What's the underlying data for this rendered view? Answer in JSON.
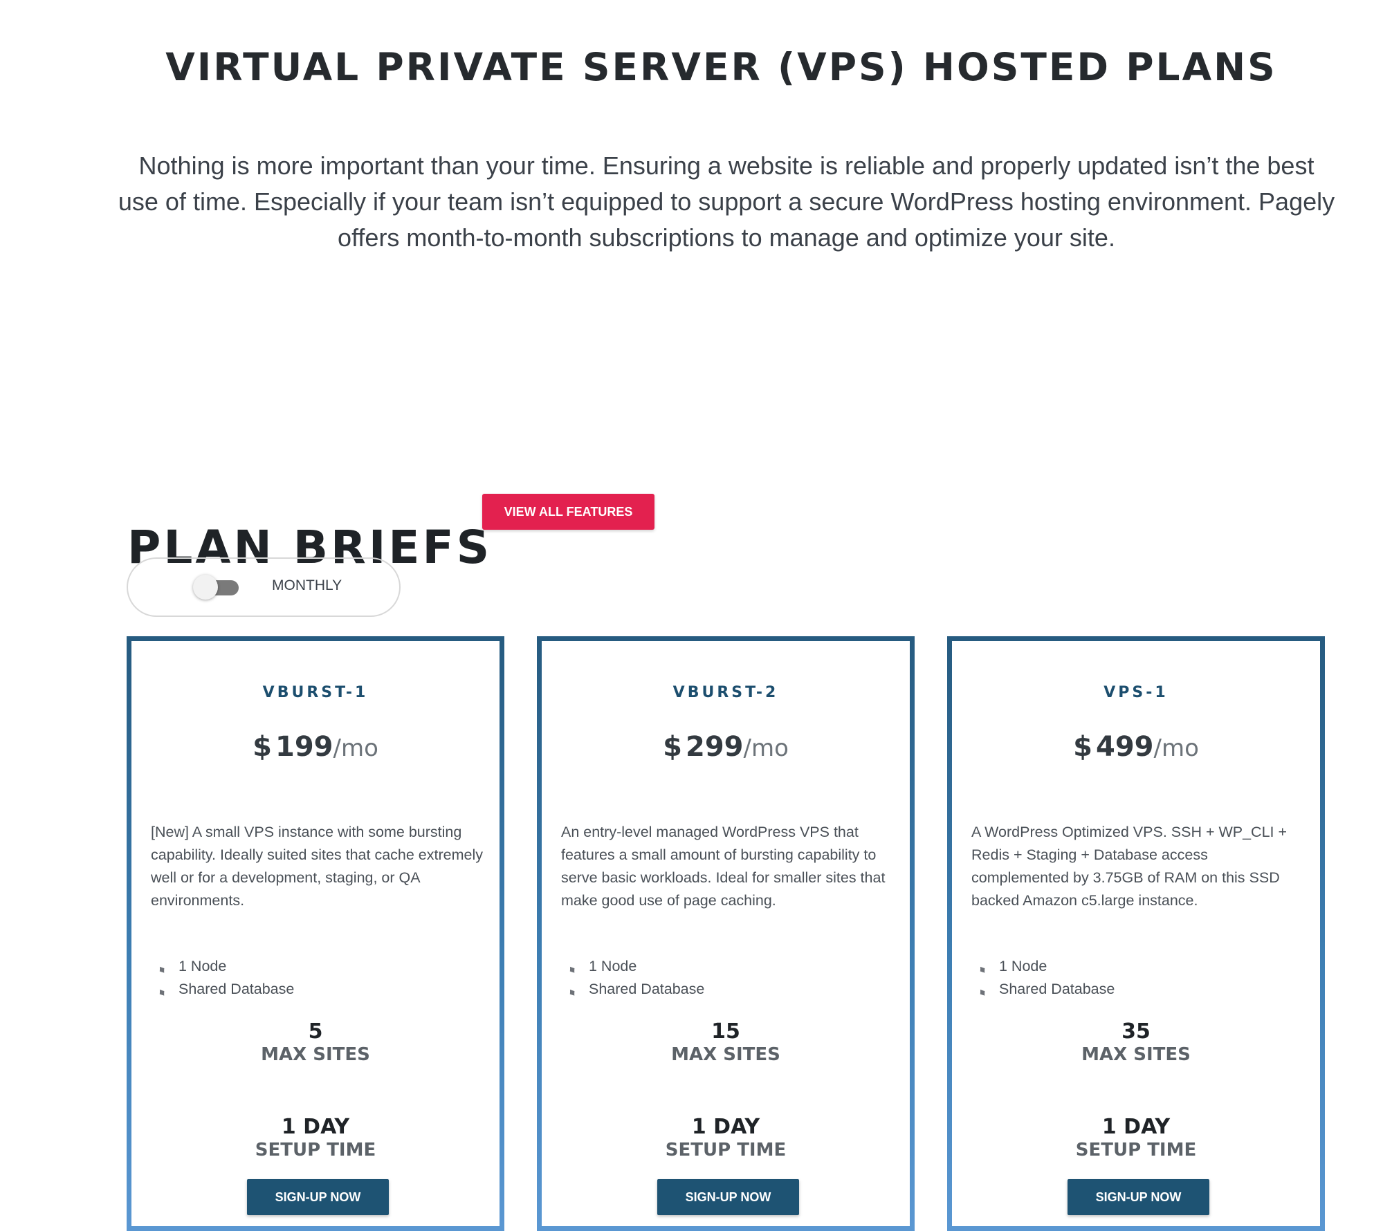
{
  "header": {
    "title": "VIRTUAL PRIVATE SERVER (VPS) HOSTED PLANS",
    "intro": "Nothing is more important than your time. Ensuring a website is reliable and properly updated isn’t the best use of time. Especially if your team isn’t equipped to support a secure WordPress hosting environment. Pagely offers month-to-month subscriptions to manage and optimize your site."
  },
  "briefs": {
    "heading": "PLAN BRIEFS",
    "view_all_label": "VIEW ALL FEATURES",
    "toggle": {
      "label": "MONTHLY",
      "state": "off"
    }
  },
  "colors": {
    "accent_red": "#e3214f",
    "brand_blue": "#1e5373",
    "card_border": "#2c6c94"
  },
  "plans": [
    {
      "name": "VBURST-1",
      "currency": "$",
      "price": "199",
      "period": "/mo",
      "description": "[New] A small VPS instance with some bursting capability. Ideally suited sites that cache extremely well or for a development, staging, or QA environments.",
      "features": [
        "1 Node",
        "Shared Database"
      ],
      "max_sites": "5",
      "max_sites_label": "MAX SITES",
      "setup_time": "1 DAY",
      "setup_label": "SETUP TIME",
      "cta": "SIGN-UP NOW"
    },
    {
      "name": "VBURST-2",
      "currency": "$",
      "price": "299",
      "period": "/mo",
      "description": "An entry-level managed WordPress VPS that features a small amount of bursting capability to serve basic workloads. Ideal for smaller sites that make good use of page caching.",
      "features": [
        "1 Node",
        "Shared Database"
      ],
      "max_sites": "15",
      "max_sites_label": "MAX SITES",
      "setup_time": "1 DAY",
      "setup_label": "SETUP TIME",
      "cta": "SIGN-UP NOW"
    },
    {
      "name": "VPS-1",
      "currency": "$",
      "price": "499",
      "period": "/mo",
      "description": "A WordPress Optimized VPS. SSH + WP_CLI + Redis + Staging + Database access complemented by 3.75GB of RAM on this SSD backed Amazon c5.large instance.",
      "features": [
        "1 Node",
        "Shared Database"
      ],
      "max_sites": "35",
      "max_sites_label": "MAX SITES",
      "setup_time": "1 DAY",
      "setup_label": "SETUP TIME",
      "cta": "SIGN-UP NOW"
    }
  ],
  "icons": {
    "feature": "tag-icon"
  }
}
